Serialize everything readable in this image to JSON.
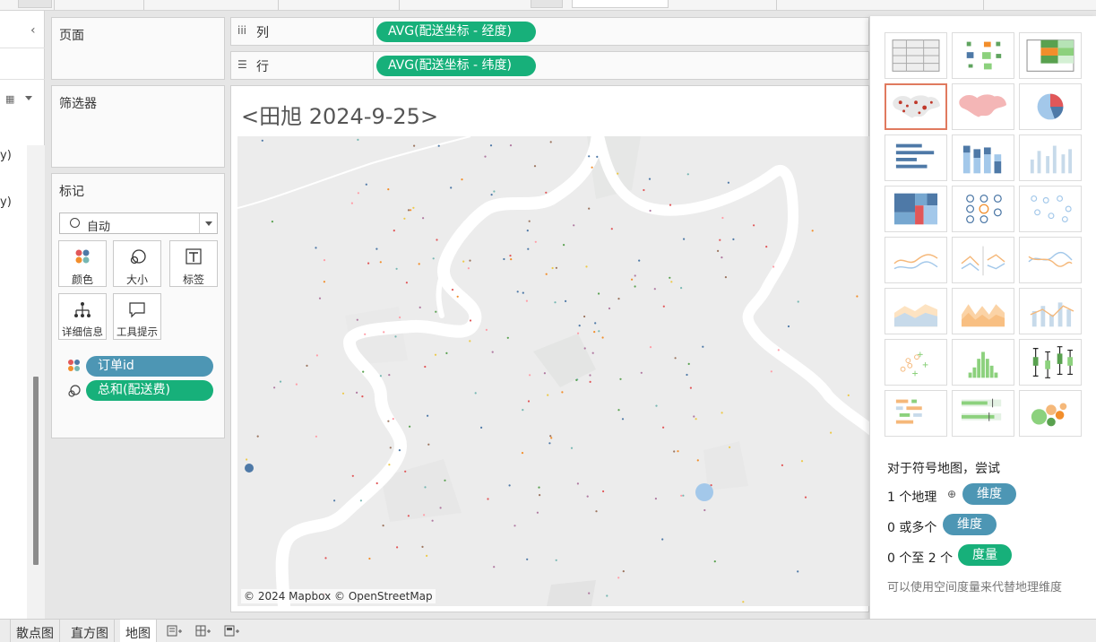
{
  "data_pane": {
    "fragment_1": "y)",
    "fragment_2": "y)"
  },
  "cards": {
    "pages_title": "页面",
    "filters_title": "筛选器",
    "marks_title": "标记",
    "marks_type": "自动",
    "mark_buttons": {
      "color": "颜色",
      "size": "大小",
      "label": "标签",
      "detail": "详细信息",
      "tooltip": "工具提示"
    },
    "mark_fields": [
      {
        "label": "订单id",
        "role": "dimension"
      },
      {
        "label": "总和(配送费)",
        "role": "measure"
      }
    ]
  },
  "shelves": {
    "columns": {
      "label": "列",
      "pill": "AVG(配送坐标 - 经度)"
    },
    "rows": {
      "label": "行",
      "pill": "AVG(配送坐标 - 纬度)"
    }
  },
  "view": {
    "title": "<田旭 2024-9-25>",
    "attribution": "© 2024 Mapbox © OpenStreetMap"
  },
  "show_me": {
    "hint_title": "对于符号地图，尝试",
    "req1_prefix": "1 个地理",
    "req1_pill": "维度",
    "req2_prefix": "0 或多个",
    "req2_pill": "维度",
    "req3_prefix": "0 个至 2 个",
    "req3_pill": "度量",
    "note": "可以使用空间度量来代替地理维度"
  },
  "tabs": [
    {
      "label": "散点图"
    },
    {
      "label": "直方图"
    },
    {
      "label": "地图",
      "active": true
    }
  ],
  "colors": {
    "dimension_pill": "#4d96b4",
    "measure_pill": "#17b07a",
    "selected_chart_border": "#e07a5f"
  }
}
